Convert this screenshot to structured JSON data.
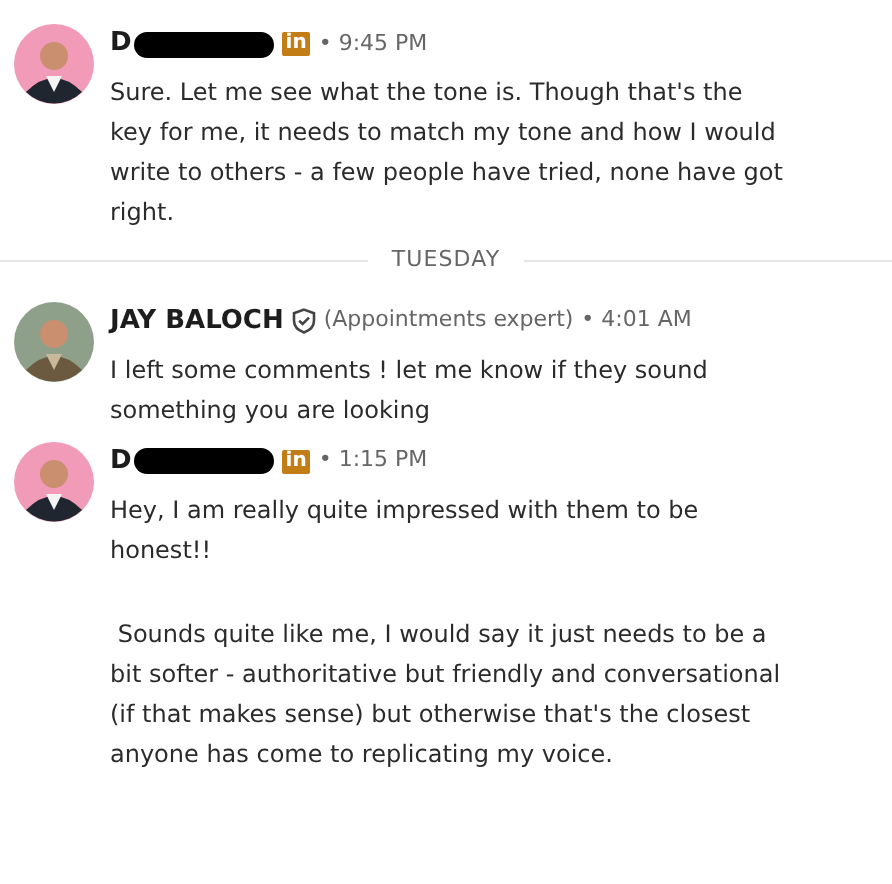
{
  "messages": [
    {
      "kind": "message",
      "color": "#f19bb8",
      "sender": "D",
      "redacted": true,
      "badge": {
        "kind": "linkedin",
        "text": "in"
      },
      "time": "• 9:45 PM",
      "text": "Sure. Let me see what the tone is. Though that's the key for me, it needs to match my tone and how I would write to others - a few people have tried, none have got right."
    },
    {
      "kind": "divider",
      "text": "TUESDAY"
    },
    {
      "kind": "message",
      "color": "#8fa08a",
      "sender": "JAY BALOCH",
      "redacted": false,
      "badge": {
        "kind": "verified"
      },
      "role": "(Appointments expert)",
      "time": "• 4:01 AM",
      "text": "I left some comments ! let me know if they sound something you are looking"
    },
    {
      "kind": "message",
      "color": "#f19bb8",
      "sender": "D",
      "redacted": true,
      "badge": {
        "kind": "linkedin",
        "text": "in"
      },
      "time": "• 1:15 PM",
      "text": "Hey, I am really quite impressed with them to be honest!!"
    },
    {
      "kind": "continuation",
      "text": " Sounds quite like me, I would say it just needs to be a bit softer - authoritative but friendly and conversational (if that makes sense) but otherwise that's the closest anyone has come to replicating my voice."
    }
  ]
}
